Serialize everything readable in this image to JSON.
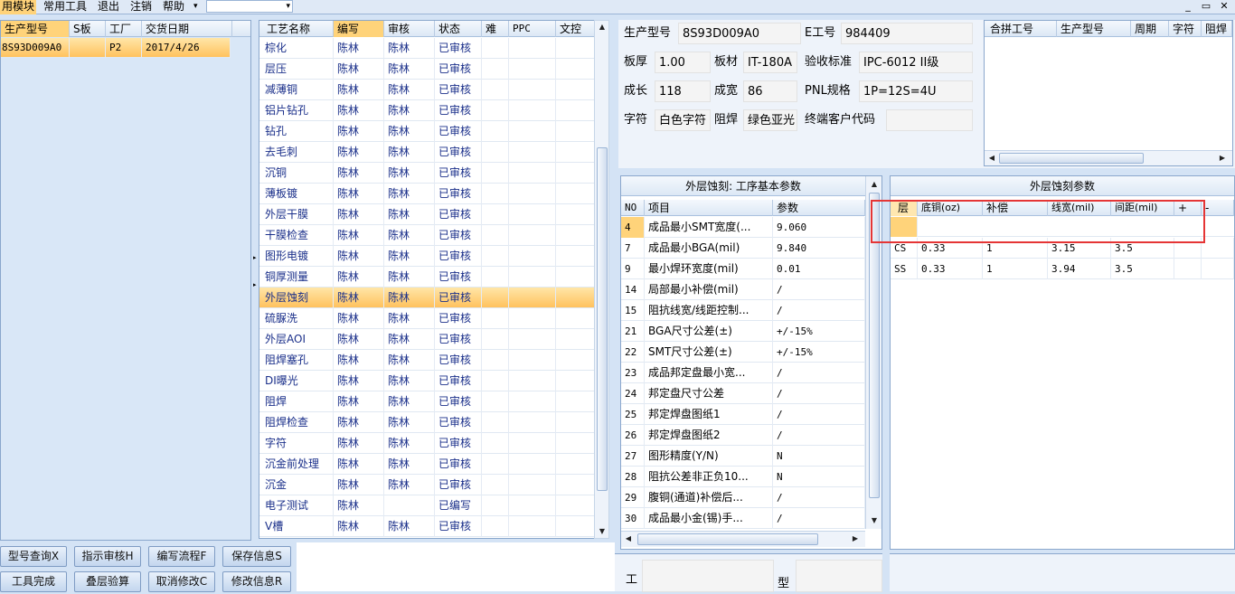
{
  "menubar": {
    "items": [
      "用模块",
      "常用工具",
      "退出",
      "注销",
      "帮助"
    ],
    "help_dropdown": "▾",
    "window_buttons": [
      "_",
      "▭",
      "✕"
    ]
  },
  "left_grid": {
    "headers": [
      "生产型号",
      "S板",
      "工厂",
      "交货日期"
    ],
    "rows": [
      [
        "8S93D009A0",
        "",
        "P2",
        "2017/4/26"
      ]
    ]
  },
  "process_grid": {
    "headers": [
      "工艺名称",
      "编写",
      "审核",
      "状态",
      "难",
      "PPC",
      "文控"
    ],
    "rows": [
      [
        "棕化",
        "陈林",
        "陈林",
        "已审核"
      ],
      [
        "层压",
        "陈林",
        "陈林",
        "已审核"
      ],
      [
        "减薄铜",
        "陈林",
        "陈林",
        "已审核"
      ],
      [
        "铝片钻孔",
        "陈林",
        "陈林",
        "已审核"
      ],
      [
        "钻孔",
        "陈林",
        "陈林",
        "已审核"
      ],
      [
        "去毛刺",
        "陈林",
        "陈林",
        "已审核"
      ],
      [
        "沉铜",
        "陈林",
        "陈林",
        "已审核"
      ],
      [
        "薄板镀",
        "陈林",
        "陈林",
        "已审核"
      ],
      [
        "外层干膜",
        "陈林",
        "陈林",
        "已审核"
      ],
      [
        "干膜检查",
        "陈林",
        "陈林",
        "已审核"
      ],
      [
        "图形电镀",
        "陈林",
        "陈林",
        "已审核"
      ],
      [
        "铜厚测量",
        "陈林",
        "陈林",
        "已审核"
      ],
      [
        "外层蚀刻",
        "陈林",
        "陈林",
        "已审核"
      ],
      [
        "硫脲洗",
        "陈林",
        "陈林",
        "已审核"
      ],
      [
        "外层AOI",
        "陈林",
        "陈林",
        "已审核"
      ],
      [
        "阻焊塞孔",
        "陈林",
        "陈林",
        "已审核"
      ],
      [
        "DI曝光",
        "陈林",
        "陈林",
        "已审核"
      ],
      [
        "阻焊",
        "陈林",
        "陈林",
        "已审核"
      ],
      [
        "阻焊检查",
        "陈林",
        "陈林",
        "已审核"
      ],
      [
        "字符",
        "陈林",
        "陈林",
        "已审核"
      ],
      [
        "沉金前处理",
        "陈林",
        "陈林",
        "已审核"
      ],
      [
        "沉金",
        "陈林",
        "陈林",
        "已审核"
      ],
      [
        "电子测试",
        "陈林",
        "",
        "已编写"
      ],
      [
        "V槽",
        "陈林",
        "陈林",
        "已审核"
      ]
    ]
  },
  "buttons": {
    "query": "型号查询X",
    "show_review": "指示审核H",
    "edit_flow": "编写流程F",
    "save_info": "保存信息S",
    "work_done": "工具完成",
    "stack_calc": "叠层验算",
    "cancel_edit": "取消修改C",
    "modify_info": "修改信息R"
  },
  "info": {
    "model_label": "生产型号",
    "model_value": "8S93D009A0",
    "eno_label": "E工号",
    "eno_value": "984409",
    "thickness_label": "板厚",
    "thickness_value": "1.00",
    "material_label": "板材",
    "material_value": "IT-180A",
    "standard_label": "验收标准",
    "standard_value": "IPC-6012 II级",
    "length_label": "成长",
    "length_value": "118",
    "width_label": "成宽",
    "width_value": "86",
    "pnl_label": "PNL规格",
    "pnl_value": "1P=12S=4U",
    "char_label": "字符",
    "char_value": "白色字符",
    "mask_label": "阻焊",
    "mask_value": "绿色亚光",
    "customer_label": "终端客户代码",
    "customer_value": ""
  },
  "merge_grid": {
    "headers": [
      "合拼工号",
      "生产型号",
      "周期",
      "字符",
      "阻焊"
    ]
  },
  "basic_params": {
    "title": "外层蚀刻: 工序基本参数",
    "headers": [
      "NO",
      "项目",
      "参数"
    ],
    "rows": [
      [
        "4",
        "成品最小SMT宽度(...",
        "9.060"
      ],
      [
        "7",
        "成品最小BGA(mil)",
        "9.840"
      ],
      [
        "9",
        "最小焊环宽度(mil)",
        "0.01"
      ],
      [
        "14",
        "局部最小补偿(mil)",
        "/"
      ],
      [
        "15",
        "阻抗线宽/线距控制...",
        "/"
      ],
      [
        "21",
        "BGA尺寸公差(±)",
        "+/-15%"
      ],
      [
        "22",
        "SMT尺寸公差(±)",
        "+/-15%"
      ],
      [
        "23",
        "成品邦定盘最小宽...",
        "/"
      ],
      [
        "24",
        "邦定盘尺寸公差",
        "/"
      ],
      [
        "25",
        "邦定焊盘图纸1",
        "/"
      ],
      [
        "26",
        "邦定焊盘图纸2",
        "/"
      ],
      [
        "27",
        "图形精度(Y/N)",
        "N"
      ],
      [
        "28",
        "阻抗公差非正负10...",
        "N"
      ],
      [
        "29",
        "腹铜(通道)补偿后...",
        "/"
      ],
      [
        "30",
        "成品最小金(锡)手...",
        "/"
      ]
    ]
  },
  "etch_params": {
    "title": "外层蚀刻参数",
    "headers": [
      "层",
      "底铜(oz)",
      "补偿",
      "线宽(mil)",
      "间距(mil)",
      "+",
      "-"
    ],
    "rows": [
      [
        "CS",
        "0.33",
        "1",
        "3.15",
        "3.5"
      ],
      [
        "SS",
        "0.33",
        "1",
        "3.94",
        "3.5"
      ]
    ]
  },
  "bottom_labels": {
    "a": "工",
    "b": "型"
  },
  "colors": {
    "highlight": "#ffc25e",
    "annotation_box": "#e53535",
    "text_blue": "#1a2f8a"
  }
}
